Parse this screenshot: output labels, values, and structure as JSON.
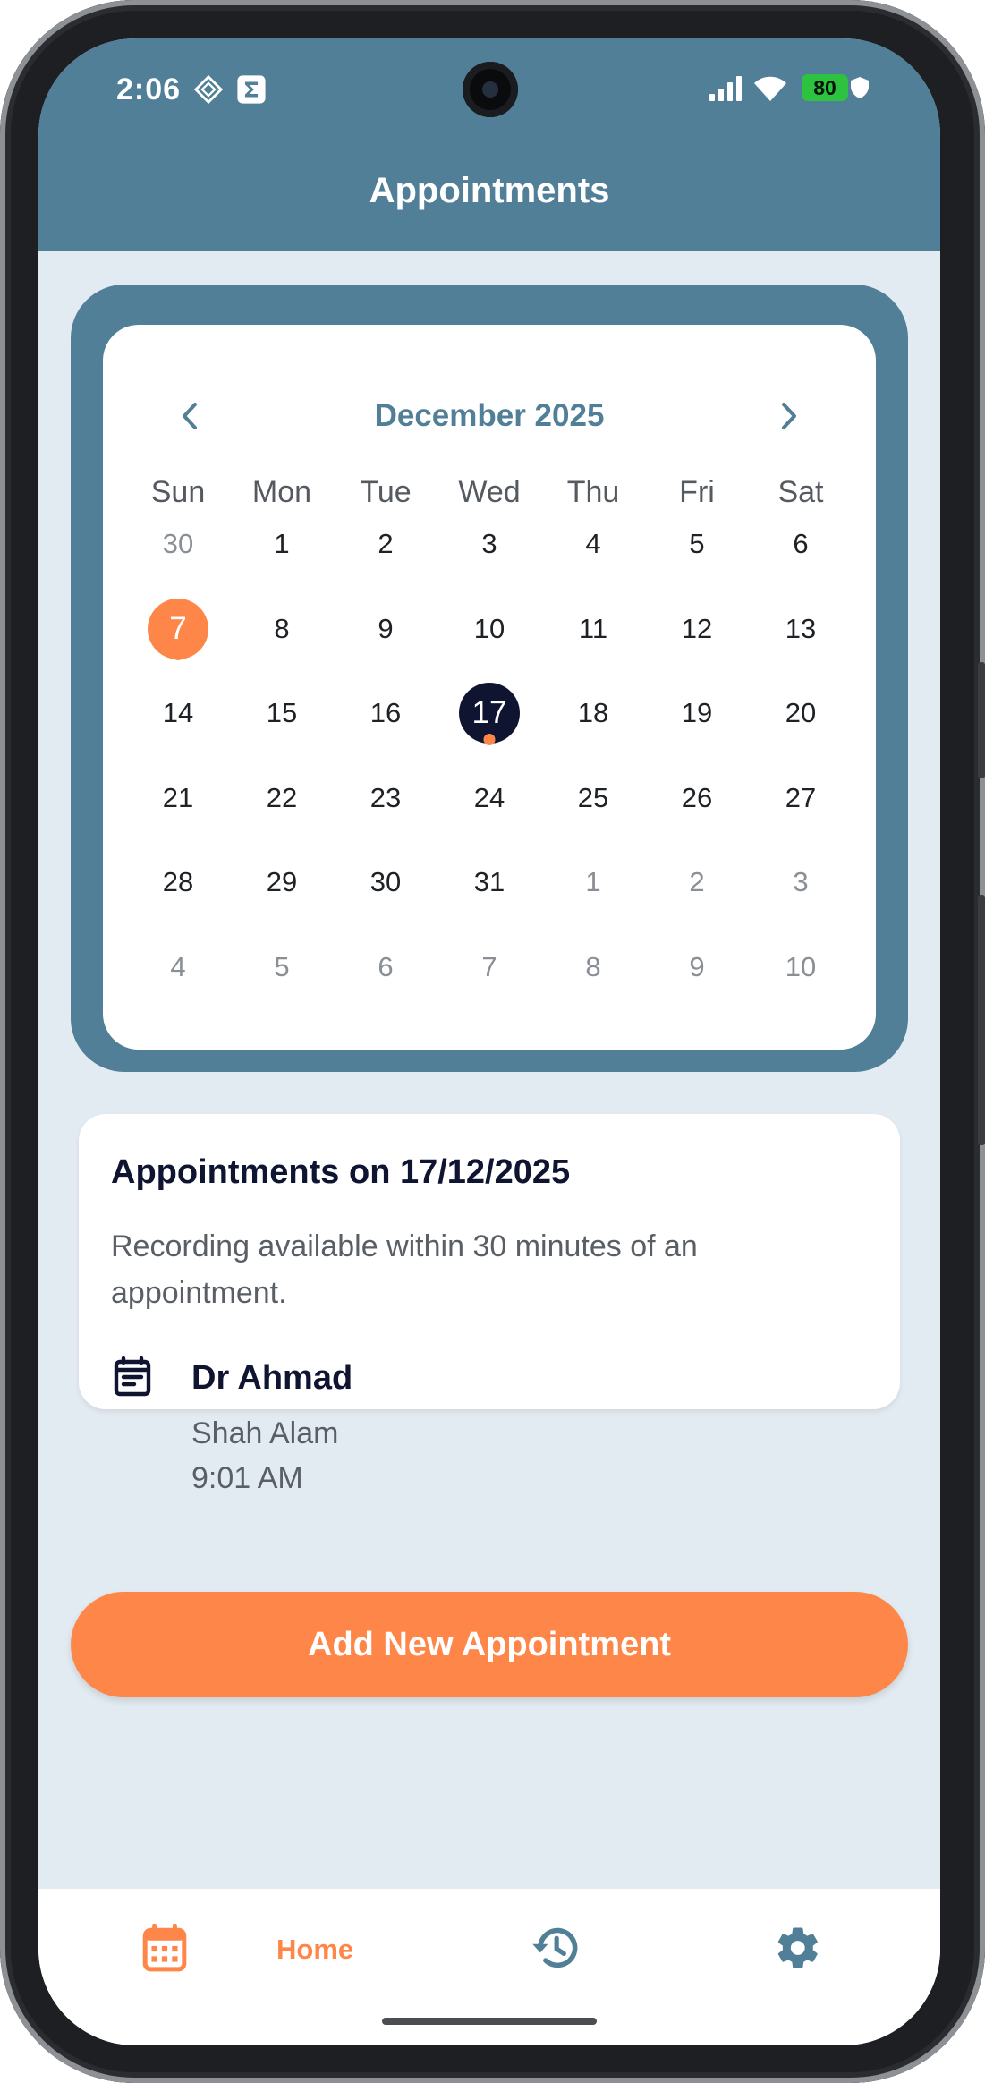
{
  "status_bar": {
    "time": "2:06",
    "battery": "80"
  },
  "header": {
    "title": "Appointments"
  },
  "calendar": {
    "month_label": "December 2025",
    "weekdays": [
      "Sun",
      "Mon",
      "Tue",
      "Wed",
      "Thu",
      "Fri",
      "Sat"
    ],
    "weeks": [
      [
        {
          "n": "30",
          "muted": true
        },
        {
          "n": "1"
        },
        {
          "n": "2"
        },
        {
          "n": "3"
        },
        {
          "n": "4"
        },
        {
          "n": "5"
        },
        {
          "n": "6"
        }
      ],
      [
        {
          "n": "7",
          "today": true,
          "dot": true
        },
        {
          "n": "8"
        },
        {
          "n": "9"
        },
        {
          "n": "10"
        },
        {
          "n": "11"
        },
        {
          "n": "12"
        },
        {
          "n": "13"
        }
      ],
      [
        {
          "n": "14"
        },
        {
          "n": "15"
        },
        {
          "n": "16"
        },
        {
          "n": "17",
          "selected": true,
          "dot": true
        },
        {
          "n": "18"
        },
        {
          "n": "19"
        },
        {
          "n": "20"
        }
      ],
      [
        {
          "n": "21"
        },
        {
          "n": "22"
        },
        {
          "n": "23"
        },
        {
          "n": "24"
        },
        {
          "n": "25"
        },
        {
          "n": "26"
        },
        {
          "n": "27"
        }
      ],
      [
        {
          "n": "28"
        },
        {
          "n": "29"
        },
        {
          "n": "30"
        },
        {
          "n": "31"
        },
        {
          "n": "1",
          "muted": true
        },
        {
          "n": "2",
          "muted": true
        },
        {
          "n": "3",
          "muted": true
        }
      ],
      [
        {
          "n": "4",
          "muted": true
        },
        {
          "n": "5",
          "muted": true
        },
        {
          "n": "6",
          "muted": true
        },
        {
          "n": "7",
          "muted": true
        },
        {
          "n": "8",
          "muted": true
        },
        {
          "n": "9",
          "muted": true
        },
        {
          "n": "10",
          "muted": true
        }
      ]
    ]
  },
  "appointments": {
    "title": "Appointments on 17/12/2025",
    "note": "Recording available within 30 minutes of an appointment.",
    "items": [
      {
        "doctor": "Dr Ahmad",
        "location": "Shah Alam",
        "time": "9:01 AM",
        "icon": "event-note-icon"
      }
    ]
  },
  "actions": {
    "add_label": "Add New Appointment"
  },
  "bottom_nav": {
    "home_label": "Home",
    "items": [
      {
        "name": "nav-home",
        "icon": "calendar-icon",
        "active": true
      },
      {
        "name": "nav-history",
        "icon": "history-icon"
      },
      {
        "name": "nav-settings",
        "icon": "gear-icon"
      }
    ]
  },
  "colors": {
    "primary": "#517f97",
    "accent": "#ff8649",
    "selected_day": "#0f1530",
    "background": "#e3ebf2"
  }
}
